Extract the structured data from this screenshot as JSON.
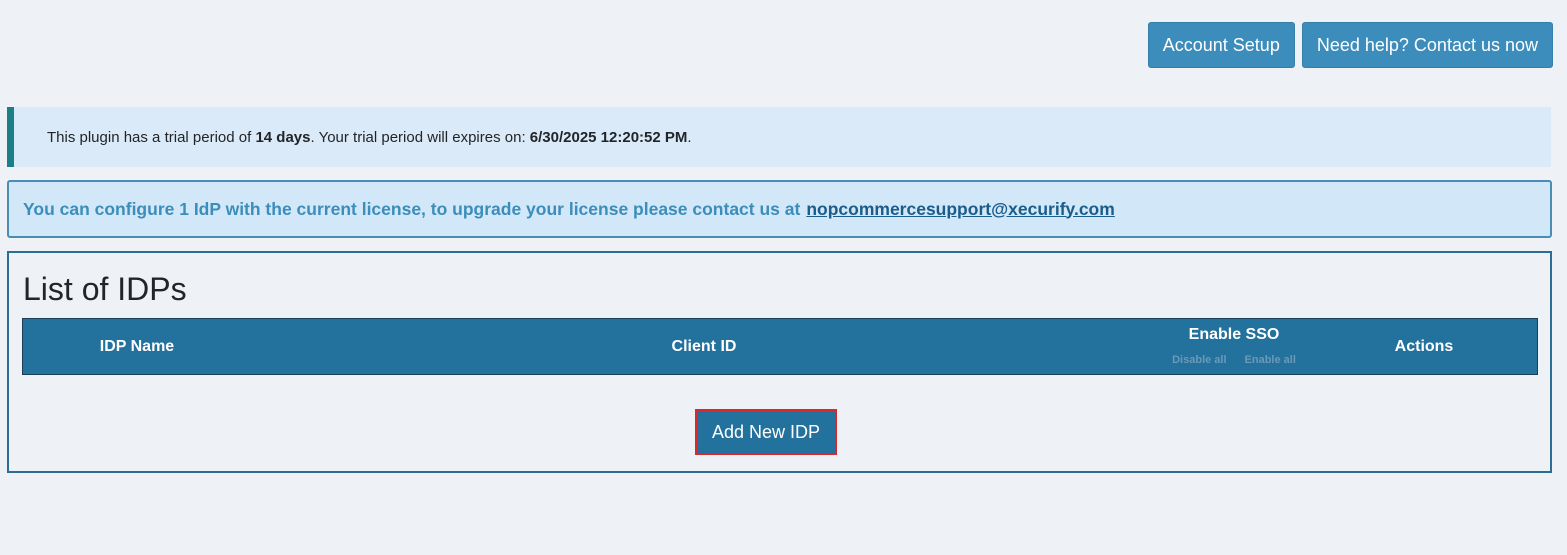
{
  "header": {
    "account_setup_label": "Account Setup",
    "help_label": "Need help? Contact us now"
  },
  "trial": {
    "prefix": "This plugin has a trial period of ",
    "days": "14 days",
    "middle": ". Your trial period will expires on: ",
    "expiry": "6/30/2025 12:20:52 PM",
    "suffix": "."
  },
  "license": {
    "message": "You can configure 1 IdP with the current license, to upgrade your license please contact us at",
    "email": "nopcommercesupport@xecurify.com"
  },
  "idp_list": {
    "title": "List of IDPs",
    "columns": {
      "name": "IDP Name",
      "client_id": "Client ID",
      "enable_sso": "Enable SSO",
      "disable_all": "Disable all",
      "enable_all": "Enable all",
      "actions": "Actions"
    },
    "rows": [],
    "add_button_label": "Add New IDP"
  },
  "colors": {
    "primary_button": "#3c8dbc",
    "table_header": "#23719d",
    "alert_text": "#3b8dba",
    "highlight_border": "#d9272e",
    "callout_border": "#1a7f86"
  }
}
